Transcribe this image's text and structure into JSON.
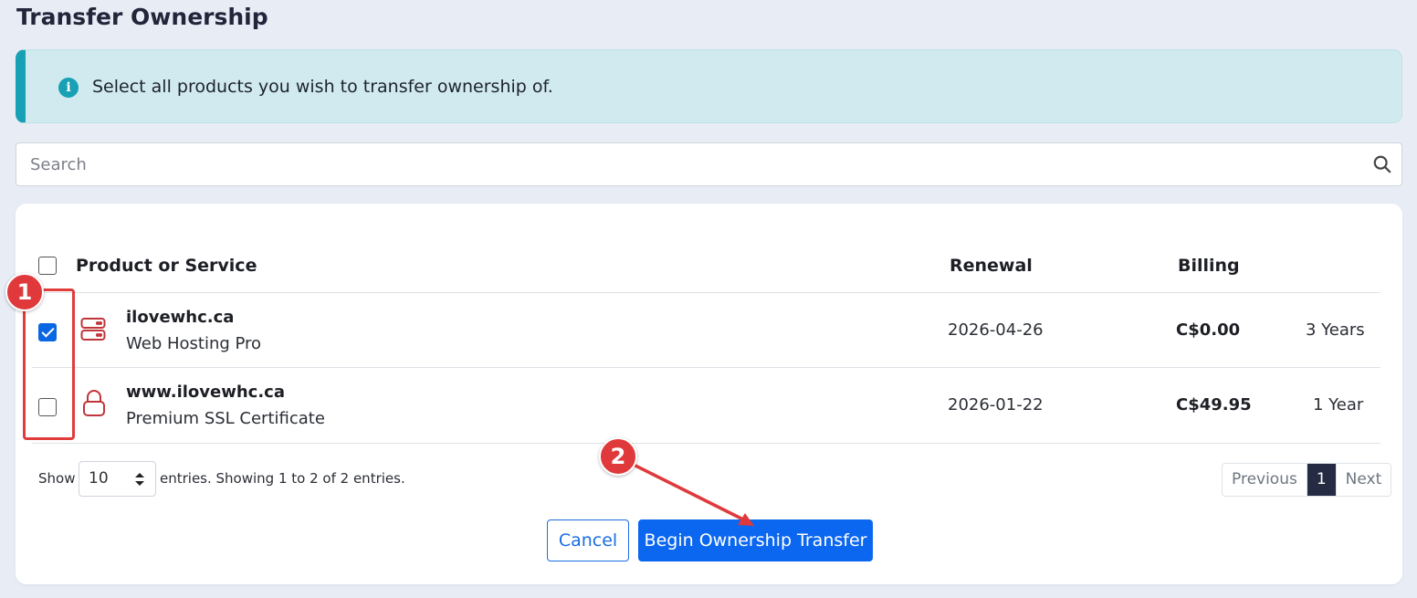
{
  "page": {
    "title": "Transfer Ownership"
  },
  "alert": {
    "text": "Select all products you wish to transfer ownership of."
  },
  "search": {
    "placeholder": "Search"
  },
  "table": {
    "headers": {
      "product": "Product or Service",
      "renewal": "Renewal",
      "billing": "Billing"
    },
    "rows": [
      {
        "name": "ilovewhc.ca",
        "type": "Web Hosting Pro",
        "renewal": "2026-04-26",
        "price": "C$0.00",
        "cycle": "3 Years",
        "checked": true,
        "icon": "server-icon"
      },
      {
        "name": "www.ilovewhc.ca",
        "type": "Premium SSL Certificate",
        "renewal": "2026-01-22",
        "price": "C$49.95",
        "cycle": "1 Year",
        "checked": false,
        "icon": "lock-icon"
      }
    ]
  },
  "footer": {
    "show_label": "Show",
    "page_size": "10",
    "entries_text": "entries. Showing 1 to 2 of 2 entries.",
    "pagination": {
      "previous": "Previous",
      "current": "1",
      "next": "Next"
    }
  },
  "actions": {
    "cancel": "Cancel",
    "submit": "Begin Ownership Transfer"
  },
  "annotations": {
    "step1": "1",
    "step2": "2"
  },
  "colors": {
    "accent": "#0b66f0",
    "icon_red": "#c0353a",
    "annotation_red": "#e0393b",
    "info": "#18a0b4"
  }
}
